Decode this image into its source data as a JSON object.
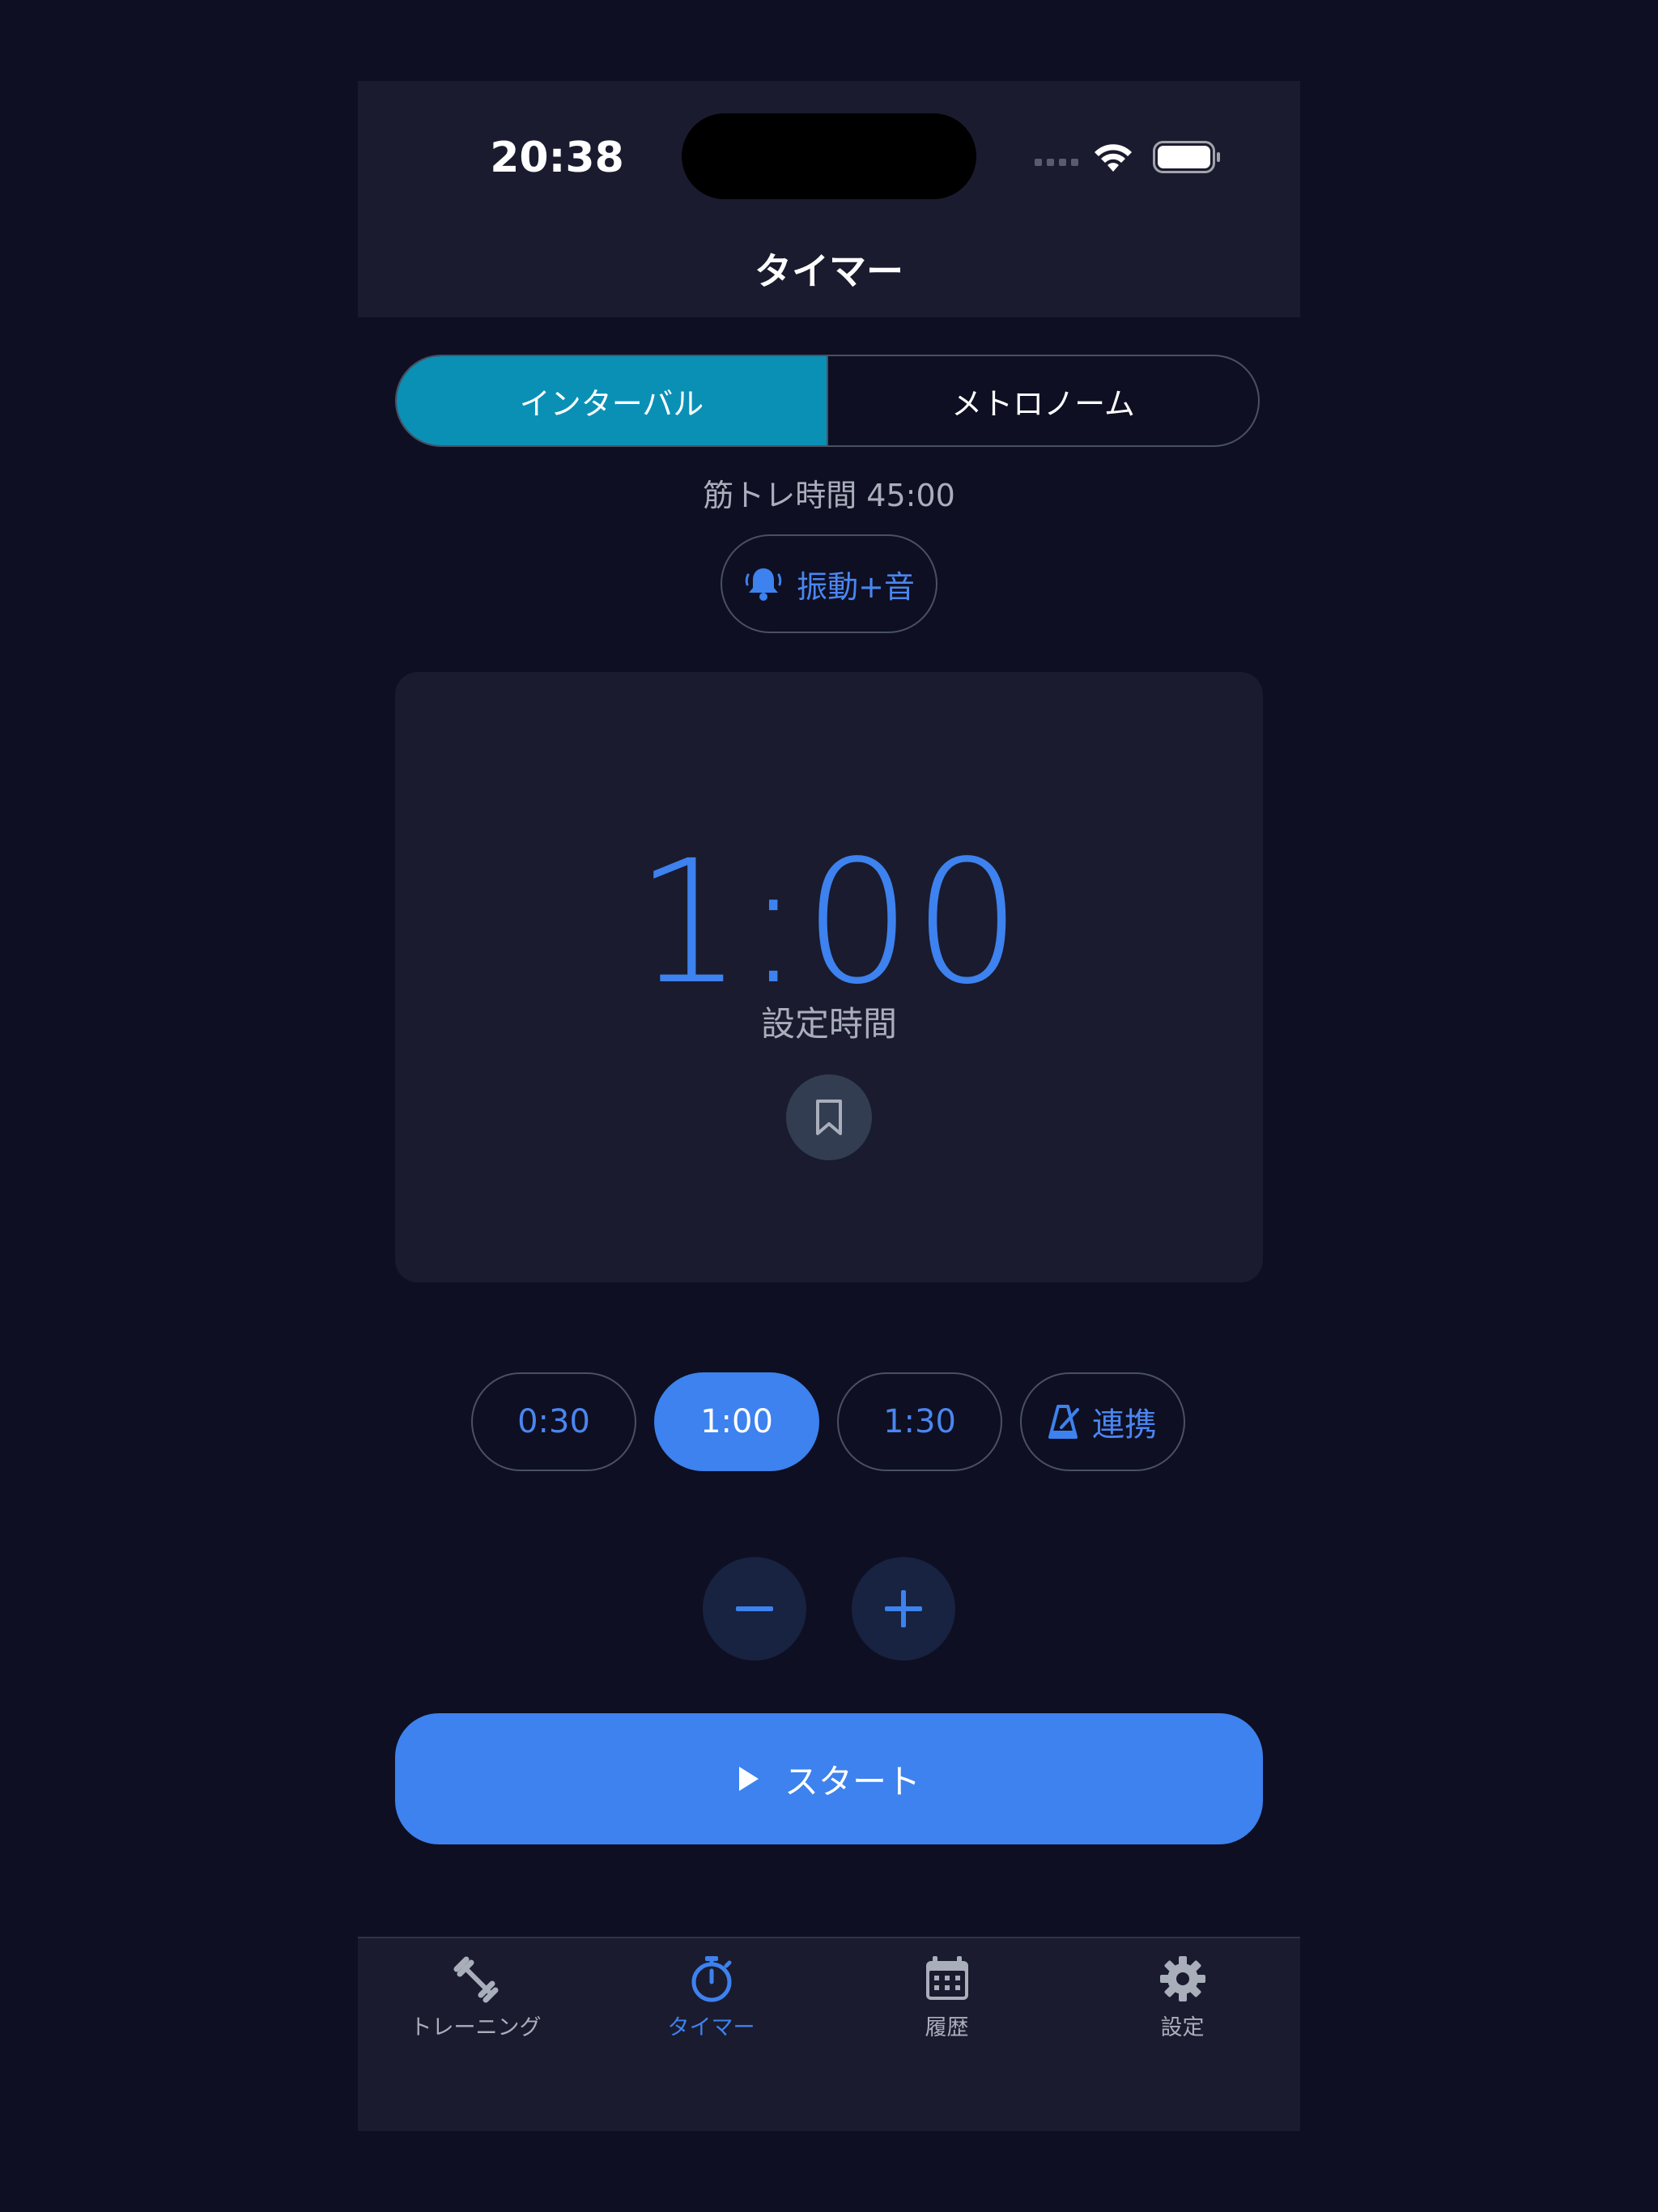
{
  "status_bar": {
    "time": "20:38"
  },
  "nav": {
    "title": "タイマー"
  },
  "mode": {
    "tabs": [
      {
        "label": "インターバル",
        "active": true
      },
      {
        "label": "メトロノーム",
        "active": false
      }
    ]
  },
  "session": {
    "text": "筋トレ時間 45:00"
  },
  "alert": {
    "label": "振動+音",
    "icon": "bell-icon"
  },
  "timer": {
    "value": "1:00",
    "label": "設定時間",
    "bookmark_icon": "bookmark-icon"
  },
  "presets": [
    {
      "label": "0:30",
      "active": false
    },
    {
      "label": "1:00",
      "active": true
    },
    {
      "label": "1:30",
      "active": false
    },
    {
      "label": "連携",
      "active": false,
      "icon": "metronome-icon"
    }
  ],
  "adjust": {
    "minus_icon": "minus-icon",
    "plus_icon": "plus-icon"
  },
  "start": {
    "label": "スタート",
    "icon": "play-icon"
  },
  "tabbar": {
    "items": [
      {
        "label": "トレーニング",
        "icon": "dumbbell-icon",
        "active": false
      },
      {
        "label": "タイマー",
        "icon": "stopwatch-icon",
        "active": true
      },
      {
        "label": "履歴",
        "icon": "calendar-icon",
        "active": false
      },
      {
        "label": "設定",
        "icon": "gear-icon",
        "active": false
      }
    ]
  },
  "colors": {
    "background": "#0e0f22",
    "surface": "#1a1b2e",
    "accent": "#3d82ee",
    "segment_active": "#0b90b5",
    "muted_text": "#a9aebb"
  }
}
